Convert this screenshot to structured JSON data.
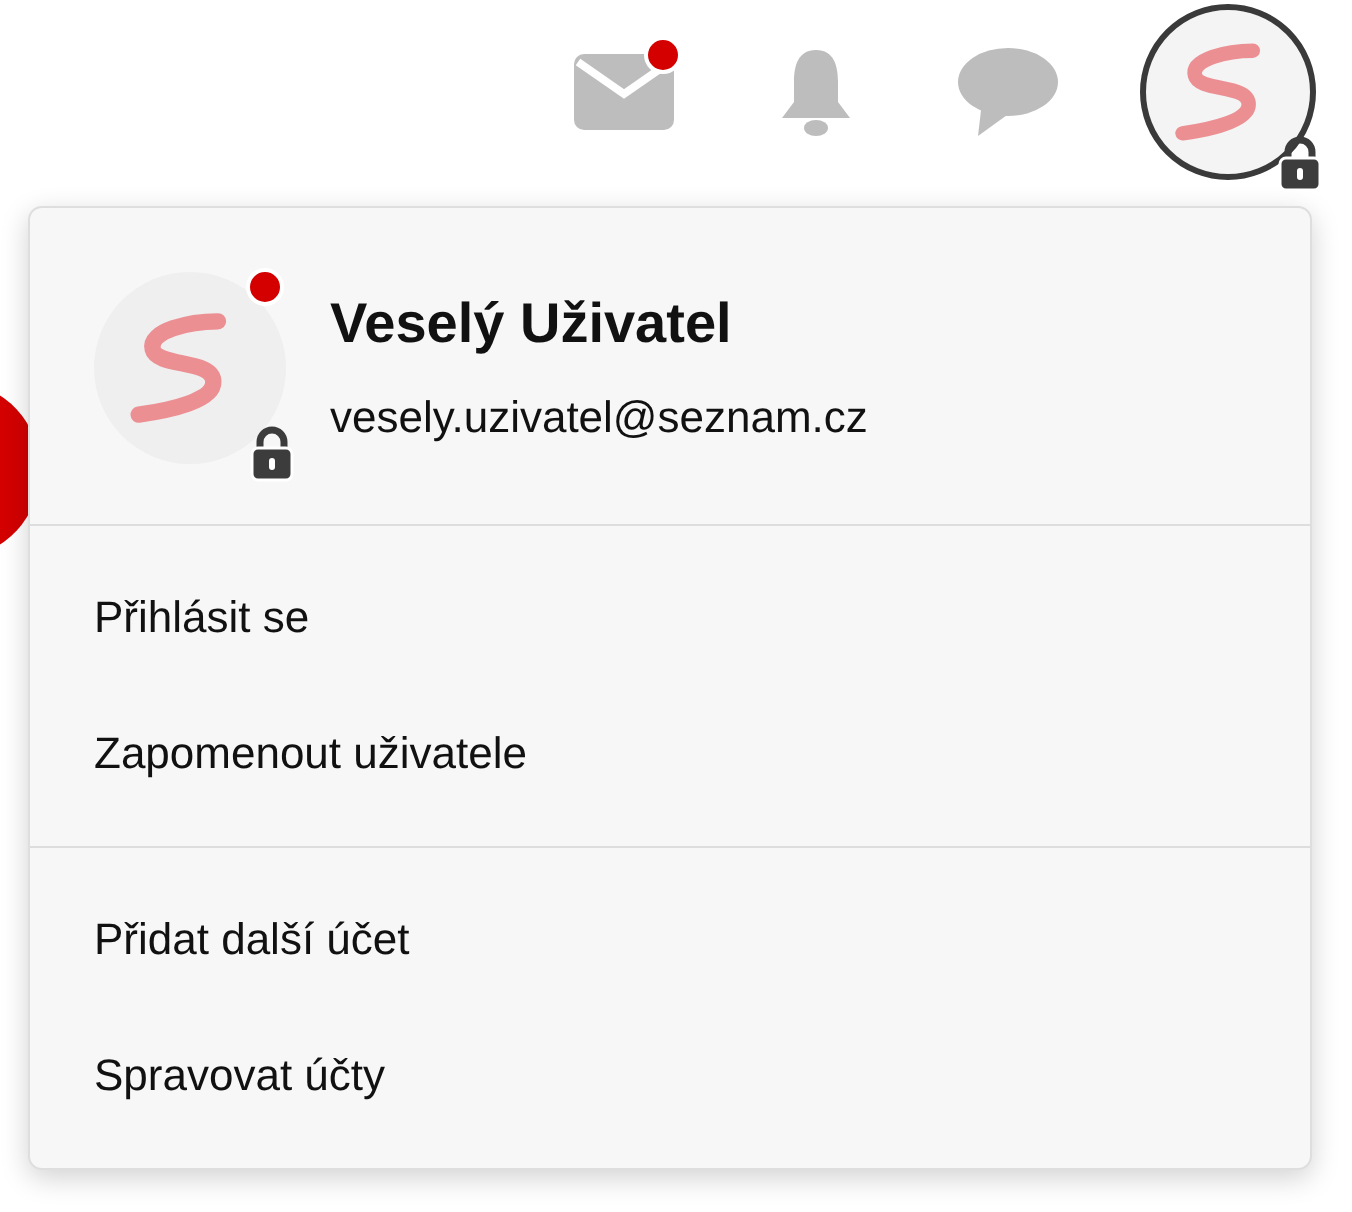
{
  "topbar": {
    "icons": [
      {
        "kind": "mail",
        "badge": true
      },
      {
        "kind": "bell",
        "badge": false
      },
      {
        "kind": "chat",
        "badge": false
      }
    ],
    "avatar": {
      "locked": true
    }
  },
  "menu": {
    "user": {
      "name": "Veselý Uživatel",
      "email": "vesely.uzivatel@seznam.cz",
      "unread": true,
      "locked": true
    },
    "sections": [
      {
        "items": [
          "Přihlásit se",
          "Zapomenout uživatele"
        ]
      },
      {
        "items": [
          "Přidat další účet",
          "Spravovat účty"
        ]
      }
    ]
  }
}
